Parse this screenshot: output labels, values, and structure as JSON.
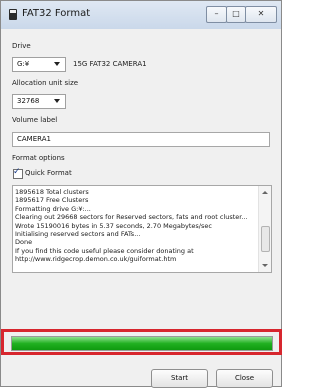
{
  "window": {
    "title": "FAT32 Format",
    "controls": {
      "minimize": "–",
      "maximize": "□",
      "close": "✕"
    }
  },
  "drive": {
    "label": "Drive",
    "selected": "G:¥",
    "info": "15G FAT32 CAMERA1"
  },
  "allocation": {
    "label": "Allocation unit size",
    "selected": "32768"
  },
  "volume": {
    "label": "Volume label",
    "value": "CAMERA1"
  },
  "format_options": {
    "label": "Format options",
    "quick_format": {
      "label": "Quick Format",
      "checked": true,
      "mark": "✓"
    }
  },
  "log": {
    "lines": [
      "1895618 Total clusters",
      "1895617 Free Clusters",
      "Formatting drive G:¥:...",
      "Clearing out 29668 sectors for Reserved sectors, fats and root cluster...",
      "Wrote 15190016 bytes in 5.37 seconds, 2.70 Megabytes/sec",
      "Initialising reserved sectors and FATs...",
      "Done",
      "If you find this code useful please consider donating at",
      "http://www.ridgecrop.demon.co.uk/guiformat.htm"
    ]
  },
  "progress": {
    "value": 1.0,
    "color": "#20b020"
  },
  "highlight_color": "#d7262e",
  "buttons": {
    "start": "Start",
    "close": "Close"
  },
  "icons": {
    "app": "usb-drive-icon",
    "dropdown": "chevron-down-icon",
    "scroll_up": "scroll-up-arrow-icon",
    "scroll_down": "scroll-down-arrow-icon"
  }
}
